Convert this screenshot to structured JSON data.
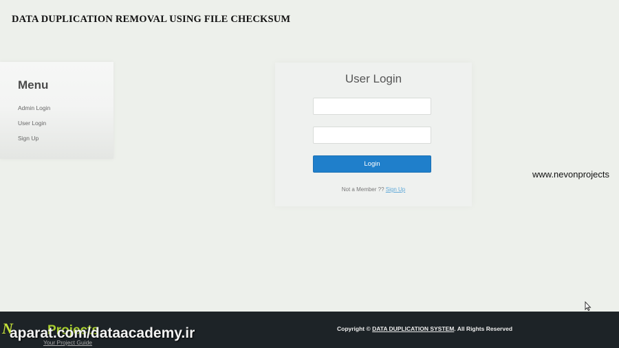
{
  "header": {
    "title": "DATA DUPLICATION REMOVAL USING FILE CHECKSUM"
  },
  "menu": {
    "title": "Menu",
    "items": [
      {
        "label": "Admin Login"
      },
      {
        "label": "User Login"
      },
      {
        "label": "Sign Up"
      }
    ]
  },
  "login": {
    "title": "User Login",
    "username_value": "",
    "password_value": "",
    "button_label": "Login",
    "member_text": "Not a Member ??",
    "signup_label": "Sign Up"
  },
  "watermark": {
    "url": "www.nevonprojects",
    "logo_mark": "N",
    "logo_word": "Projects",
    "logo_tagline": "Your Project Guide",
    "overlay_text": "aparat.com/dataacademy.ir"
  },
  "footer": {
    "copyright_prefix": "Copyright ©",
    "copyright_link": "DATA DUPLICATION SYSTEM",
    "copyright_suffix": ". All Rights Reserved"
  },
  "colors": {
    "background": "#edf0eb",
    "accent": "#1f7fcb",
    "footer": "#1d2327",
    "logo_green": "#a9cf2f"
  }
}
